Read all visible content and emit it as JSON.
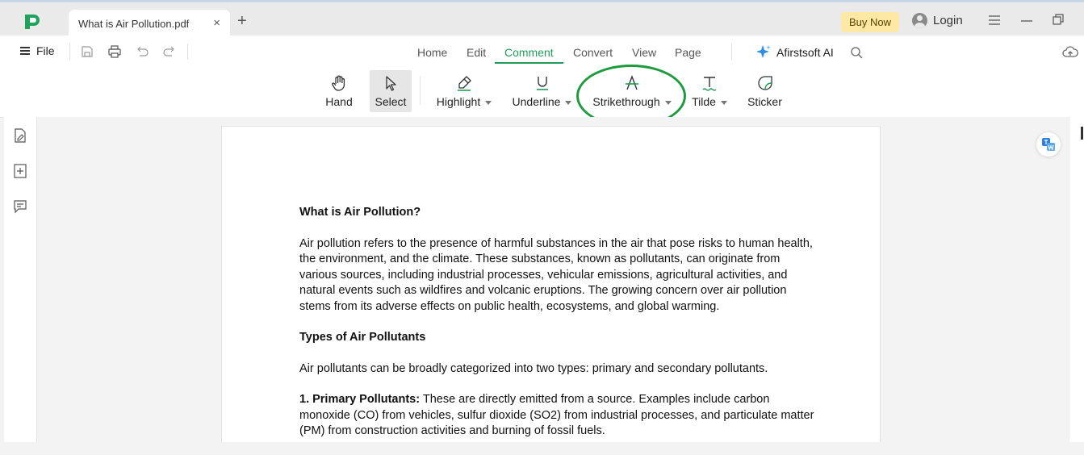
{
  "tab": {
    "title": "What is Air Pollution.pdf",
    "close": "×",
    "new": "+"
  },
  "account": {
    "buy_now": "Buy Now",
    "login": "Login"
  },
  "file_menu": {
    "label": "File"
  },
  "quick_access": [
    "save-icon",
    "print-icon",
    "undo-icon",
    "redo-icon"
  ],
  "menu_tabs": [
    {
      "label": "Home"
    },
    {
      "label": "Edit"
    },
    {
      "label": "Comment",
      "active": true
    },
    {
      "label": "Convert"
    },
    {
      "label": "View"
    },
    {
      "label": "Page"
    }
  ],
  "ai": {
    "label": "Afirstsoft AI"
  },
  "tools": [
    {
      "label": "Hand",
      "icon": "hand-icon"
    },
    {
      "label": "Select",
      "icon": "cursor-icon",
      "active": true
    },
    {
      "label": "Highlight",
      "icon": "highlighter-icon",
      "dropdown": true
    },
    {
      "label": "Underline",
      "icon": "underline-icon",
      "dropdown": true
    },
    {
      "label": "Strikethrough",
      "icon": "strikethrough-icon",
      "dropdown": true
    },
    {
      "label": "Tilde",
      "icon": "tilde-icon",
      "dropdown": true
    },
    {
      "label": "Sticker",
      "icon": "sticker-icon"
    }
  ],
  "colors": {
    "accent": "#1f9d5a",
    "annotation": "#1f9a3f",
    "buy_now_bg": "#fde8a6"
  },
  "document": {
    "heading1": "What is Air Pollution?",
    "para1": "Air pollution refers to the presence of harmful substances in the air that pose risks to human health, the environment, and the climate. These substances, known as pollutants, can originate from various sources, including industrial processes, vehicular emissions, agricultural activities, and natural events such as wildfires and volcanic eruptions. The growing concern over air pollution stems from its adverse effects on public health, ecosystems, and global warming.",
    "heading2": "Types of Air Pollutants",
    "para2": "Air pollutants can be broadly categorized into two types: primary and secondary pollutants.",
    "para3_bold": "1. Primary Pollutants:",
    "para3_rest": " These are directly emitted from a source. Examples include carbon monoxide (CO) from vehicles, sulfur dioxide (SO2) from industrial processes, and particulate matter (PM) from construction activities and burning of fossil fuels."
  }
}
